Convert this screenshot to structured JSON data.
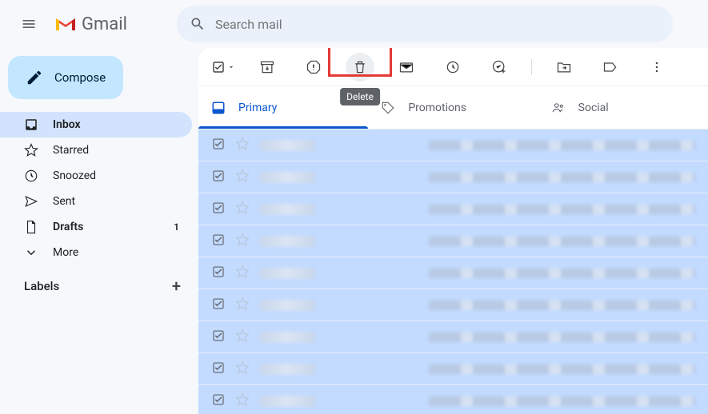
{
  "app": {
    "name": "Gmail"
  },
  "search": {
    "placeholder": "Search mail"
  },
  "compose": {
    "label": "Compose"
  },
  "sidebar": {
    "items": [
      {
        "label": "Inbox",
        "active": true
      },
      {
        "label": "Starred"
      },
      {
        "label": "Snoozed"
      },
      {
        "label": "Sent"
      },
      {
        "label": "Drafts",
        "count": "1",
        "bold": true
      },
      {
        "label": "More"
      }
    ],
    "labels_header": "Labels"
  },
  "toolbar": {
    "delete_tooltip": "Delete"
  },
  "tabs": [
    {
      "label": "Primary",
      "active": true
    },
    {
      "label": "Promotions"
    },
    {
      "label": "Social"
    }
  ],
  "emails": [
    {},
    {},
    {},
    {},
    {},
    {},
    {},
    {},
    {}
  ]
}
